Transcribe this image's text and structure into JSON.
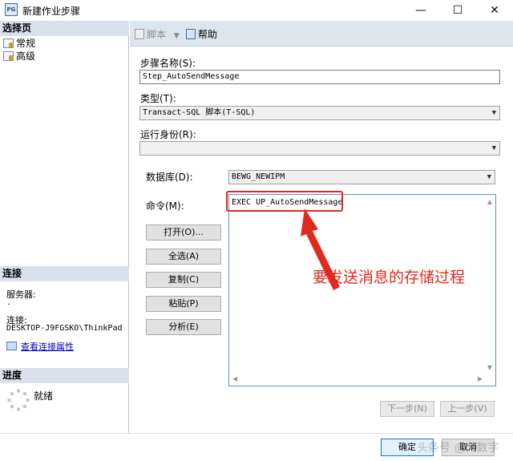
{
  "window": {
    "title": "新建作业步骤",
    "app_icon_text": "PG",
    "controls": {
      "minimize": "—",
      "maximize": "☐",
      "close": "✕"
    }
  },
  "left": {
    "select_page_header": "选择页",
    "pages": [
      "常规",
      "高级"
    ],
    "connection_header": "连接",
    "server_label": "服务器:",
    "server_value": ".",
    "connection_label": "连接:",
    "connection_value": "DESKTOP-J9FGSKO\\ThinkPad",
    "view_connection_link": "查看连接属性",
    "progress_header": "进度",
    "progress_status": "就绪"
  },
  "toolbar": {
    "script_label": "脚本",
    "help_label": "帮助"
  },
  "form": {
    "step_name_label": "步骤名称(S):",
    "step_name_value": "Step_AutoSendMessage",
    "type_label": "类型(T):",
    "type_value": "Transact-SQL 脚本(T-SQL)",
    "run_as_label": "运行身份(R):",
    "run_as_value": "",
    "database_label": "数据库(D):",
    "database_value": "BEWG_NEWIPM",
    "command_label": "命令(M):",
    "command_value": "EXEC UP_AutoSendMessage",
    "buttons": {
      "open": "打开(O)...",
      "select_all": "全选(A)",
      "copy": "复制(C)",
      "paste": "粘贴(P)",
      "parse": "分析(E)"
    },
    "next_button": "下一步(N)",
    "prev_button": "上一步(V)"
  },
  "annotation": {
    "text": "要发送消息的存储过程",
    "color": "#e02a1e"
  },
  "footer": {
    "ok_button": "确定",
    "cancel_button": "取消",
    "watermark": "头条号 @大数字"
  },
  "colors": {
    "section_header_bg": "#d9e1ec",
    "toolbar_bg": "#dde5ef",
    "accent_border": "#5a92d2",
    "highlight": "#e02a1e"
  }
}
